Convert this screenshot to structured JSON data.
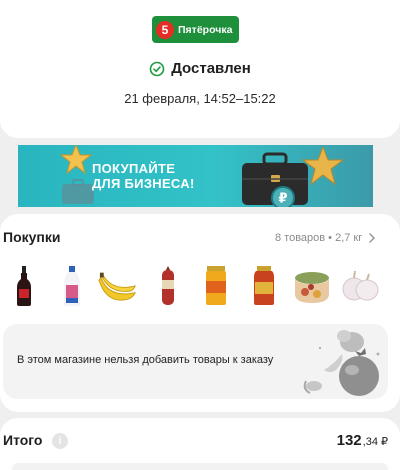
{
  "store": {
    "logo_digit": "5",
    "name": "Пятёрочка",
    "brand_color": "#1e8f3a",
    "accent_color": "#e52d27"
  },
  "order": {
    "status_icon": "check-circle-icon",
    "status": "Доставлен",
    "delivery_time": "21 февраля, 14:52–15:22"
  },
  "banner": {
    "line1": "ПОКУПАЙТЕ",
    "line2": "ДЛЯ БИЗНЕСА!",
    "bg_color": "#33c2c8"
  },
  "purchases": {
    "title": "Покупки",
    "summary": "8 товаров • 2,7 кг",
    "products": [
      {
        "name": "sauce-bottle-icon"
      },
      {
        "name": "yogurt-bottle-icon"
      },
      {
        "name": "bananas-icon"
      },
      {
        "name": "sausage-icon"
      },
      {
        "name": "canned-jar-icon"
      },
      {
        "name": "tomato-sauce-jar-icon"
      },
      {
        "name": "salad-container-icon"
      },
      {
        "name": "garlic-icon"
      }
    ],
    "notice": "В этом магазине нельзя добавить товары к заказу"
  },
  "total": {
    "label": "Итого",
    "amount_major": "132",
    "amount_minor": ",34 ₽"
  }
}
